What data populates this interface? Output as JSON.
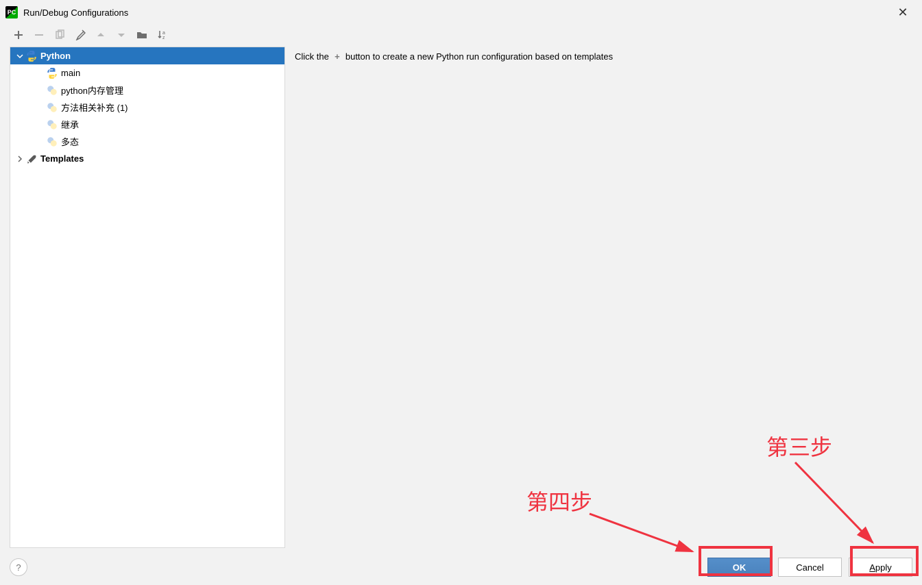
{
  "window": {
    "title": "Run/Debug Configurations"
  },
  "toolbar": {
    "add": "plus-icon",
    "remove": "minus-icon",
    "copy": "copy-icon",
    "edit_defaults": "wrench-icon",
    "move_up": "up-icon",
    "move_down": "down-icon",
    "folder": "folder-icon",
    "sort": "sort-az-icon"
  },
  "tree": {
    "python_group": "Python",
    "items": [
      {
        "label": "main",
        "faded": false
      },
      {
        "label": "python内存管理",
        "faded": true
      },
      {
        "label": "方法相关补充 (1)",
        "faded": true
      },
      {
        "label": "继承",
        "faded": true
      },
      {
        "label": "多态",
        "faded": true
      }
    ],
    "templates": "Templates"
  },
  "content": {
    "hint_pre": "Click the",
    "hint_post": "button to create a new Python run configuration based on templates"
  },
  "footer": {
    "help": "?",
    "ok": "OK",
    "cancel": "Cancel",
    "apply": "Apply"
  },
  "annotations": {
    "step3": "第三步",
    "step4": "第四步"
  }
}
